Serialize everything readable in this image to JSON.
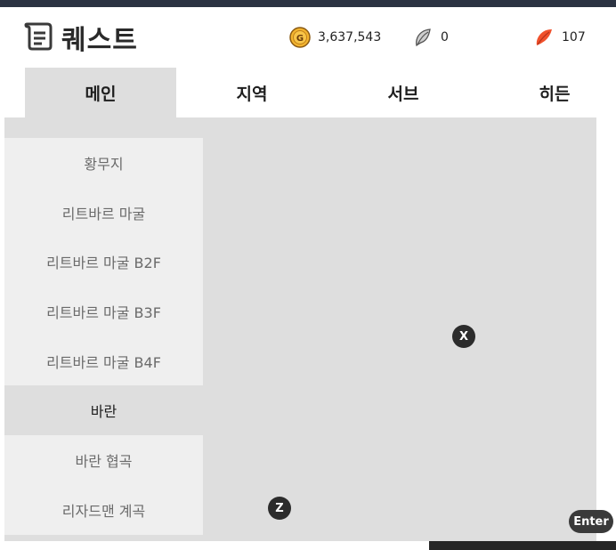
{
  "header": {
    "title": "퀘스트",
    "gold": "3,637,543",
    "feather": "0",
    "gem": "107"
  },
  "tabs": [
    {
      "label": "메인",
      "active": true
    },
    {
      "label": "지역",
      "active": false
    },
    {
      "label": "서브",
      "active": false
    },
    {
      "label": "히든",
      "active": false
    }
  ],
  "list": [
    {
      "label": "황무지",
      "active": false
    },
    {
      "label": "리트바르 마굴",
      "active": false
    },
    {
      "label": "리트바르 마굴 B2F",
      "active": false
    },
    {
      "label": "리트바르 마굴 B3F",
      "active": false
    },
    {
      "label": "리트바르 마굴 B4F",
      "active": false
    },
    {
      "label": "바란",
      "active": true
    },
    {
      "label": "바란 협곡",
      "active": false
    },
    {
      "label": "리자드맨 계곡",
      "active": false
    }
  ],
  "keys": {
    "x": "X",
    "z": "Z",
    "enter": "Enter"
  },
  "colors": {
    "gold": "#e9a92a",
    "gem": "#f0512c",
    "feather": "#8c8c8c",
    "active_tab": "#dedede"
  }
}
